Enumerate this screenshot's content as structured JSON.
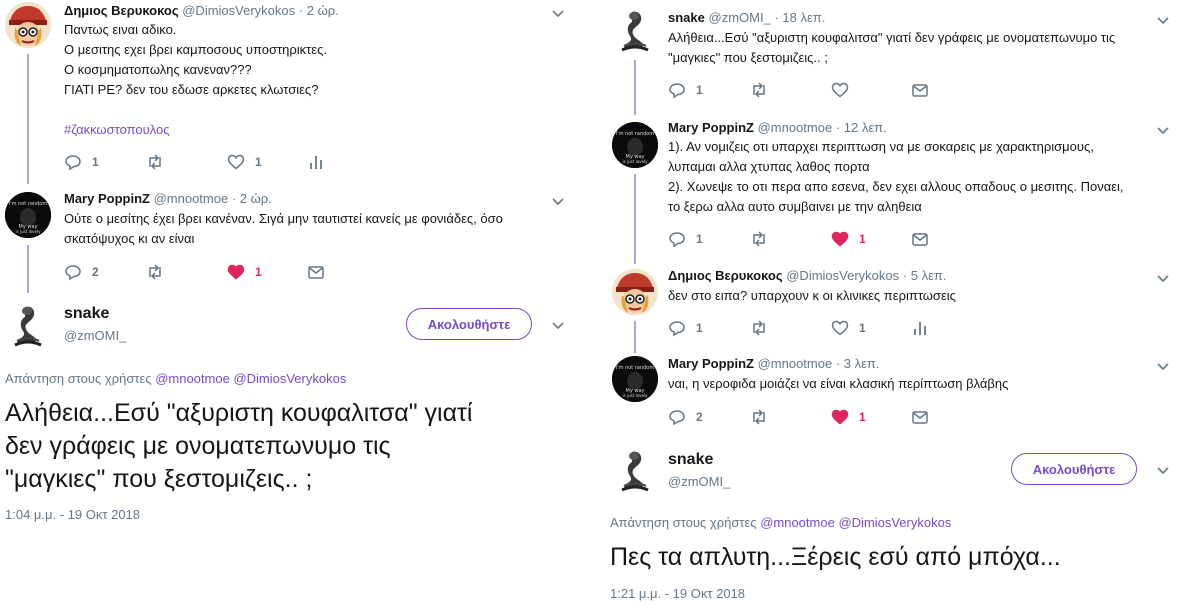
{
  "left": {
    "tweets": [
      {
        "name": "Δημιος Βερυκοκος",
        "handle": "@DimiosVerykokos",
        "time": "2 ώρ.",
        "lines": [
          "Παντως ειναι αδικο.",
          "Ο μεσιτης εχει βρει καμποσους υποστηρικτες.",
          "Ο κοσμηματοπωλης κανεναν???",
          "ΓΙΑΤΙ ΡΕ? δεν του εδωσε αρκετες κλωτσιες?"
        ],
        "hashtag": "#ζακκωστοπουλος",
        "replies": "1",
        "retweets": "",
        "likes": "1",
        "liked": false
      },
      {
        "name": "Mary PoppinZ",
        "handle": "@mnootmoe",
        "time": "2 ώρ.",
        "lines": [
          "Ούτε ο μεσίτης έχει βρει κανέναν. Σιγά μην ταυτιστεί κανείς με φονιάδες, όσο",
          "σκατόψυχος κι αν είναι"
        ],
        "replies": "2",
        "retweets": "",
        "likes": "1",
        "liked": true
      }
    ],
    "main": {
      "name": "snake",
      "handle": "@zmOMI_",
      "follow_label": "Ακολουθήστε",
      "reply_prefix": "Απάντηση στους χρήστες",
      "mention1": "@mnootmoe",
      "mention2": "@DimiosVerykokos",
      "lines": [
        "Αλήθεια...Εσύ \"αξυριστη κουφαλιτσα\" γιατί",
        "δεν γράφεις με ονοματεπωνυμο τις",
        "\"μαγκιες\" που ξεστομιζεις.. ;"
      ],
      "timestamp": "1:04 μ.μ. - 19 Οκτ 2018"
    }
  },
  "right": {
    "tweets": [
      {
        "name": "snake",
        "handle": "@zmOMI_",
        "time": "18 λεπ.",
        "lines": [
          "Αλήθεια...Εσύ \"αξυριστη κουφαλιτσα\" γιατί δεν γράφεις με ονοματεπωνυμο τις",
          "\"μαγκιες\" που ξεστομιζεις.. ;"
        ],
        "replies": "1",
        "retweets": "",
        "likes": "",
        "liked": false
      },
      {
        "name": "Mary PoppinZ",
        "handle": "@mnootmoe",
        "time": "12 λεπ.",
        "lines": [
          "1). Αν νομιζεις οτι υπαρχει περιπτωση να με σοκαρεις με χαρακτηρισμους,",
          "λυπαμαι αλλα χτυπας λαθος πορτα",
          "2). Χωνεψε το οτι περα απο εσενα, δεν εχει αλλους οπαδους ο μεσιτης. Ποναει,",
          "το ξερω αλλα αυτο συμβαινει με την αληθεια"
        ],
        "replies": "1",
        "retweets": "",
        "likes": "1",
        "liked": true
      },
      {
        "name": "Δημιος Βερυκοκος",
        "handle": "@DimiosVerykokos",
        "time": "5 λεπ.",
        "lines": [
          "δεν στο ειπα? υπαρχουν κ οι κλινικες περιπτωσεις"
        ],
        "replies": "1",
        "retweets": "",
        "likes": "1",
        "liked": false
      },
      {
        "name": "Mary PoppinZ",
        "handle": "@mnootmoe",
        "time": "3 λεπ.",
        "lines": [
          "ναι, η νεροφιδα μοιάζει να είναι κλασική περίπτωση βλάβης"
        ],
        "replies": "2",
        "retweets": "",
        "likes": "1",
        "liked": true
      }
    ],
    "main": {
      "name": "snake",
      "handle": "@zmOMI_",
      "follow_label": "Ακολουθήστε",
      "reply_prefix": "Απάντηση στους χρήστες",
      "mention1": "@mnootmoe",
      "mention2": "@DimiosVerykokos",
      "lines": [
        "Πες τα  απλυτη...Ξέρεις εσύ από μπόχα..."
      ],
      "timestamp": "1:21 μ.μ. - 19 Οκτ 2018"
    }
  },
  "avatar_texts": {
    "mary_line1": "I'm not random",
    "mary_line2": "My way",
    "mary_line3": "is just lovely"
  },
  "colors": {
    "accent": "#794bc4",
    "like": "#e0245e",
    "secondary": "#657786",
    "thread": "#b4a3db"
  }
}
